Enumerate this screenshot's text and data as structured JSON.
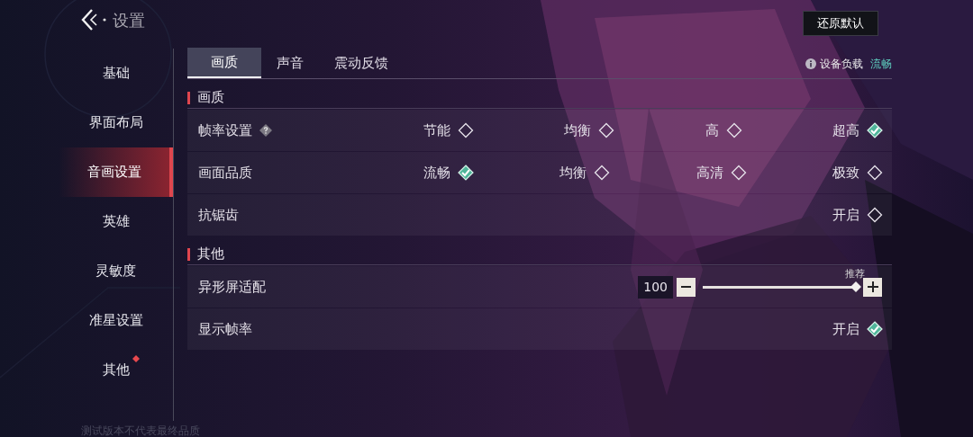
{
  "header": {
    "title": "设置",
    "reset_button": "还原默认"
  },
  "sidebar": {
    "items": [
      {
        "label": "基础",
        "selected": false,
        "badge": false
      },
      {
        "label": "界面布局",
        "selected": false,
        "badge": false
      },
      {
        "label": "音画设置",
        "selected": true,
        "badge": false
      },
      {
        "label": "英雄",
        "selected": false,
        "badge": false
      },
      {
        "label": "灵敏度",
        "selected": false,
        "badge": false
      },
      {
        "label": "准星设置",
        "selected": false,
        "badge": false
      },
      {
        "label": "其他",
        "selected": false,
        "badge": true
      }
    ]
  },
  "tabs": [
    {
      "label": "画质",
      "selected": true
    },
    {
      "label": "声音",
      "selected": false
    },
    {
      "label": "震动反馈",
      "selected": false
    }
  ],
  "device_load": {
    "label": "设备负载",
    "value": "流畅"
  },
  "sections": [
    {
      "title": "画质",
      "rows": [
        {
          "kind": "options",
          "label": "帧率设置",
          "help": true,
          "options": [
            {
              "label": "节能",
              "selected": false
            },
            {
              "label": "均衡",
              "selected": false
            },
            {
              "label": "高",
              "selected": false
            },
            {
              "label": "超高",
              "selected": true
            }
          ]
        },
        {
          "kind": "options",
          "label": "画面品质",
          "help": false,
          "options": [
            {
              "label": "流畅",
              "selected": true
            },
            {
              "label": "均衡",
              "selected": false
            },
            {
              "label": "高清",
              "selected": false
            },
            {
              "label": "极致",
              "selected": false
            }
          ]
        },
        {
          "kind": "toggle",
          "label": "抗锯齿",
          "value_label": "开启",
          "checked": false
        }
      ]
    },
    {
      "title": "其他",
      "rows": [
        {
          "kind": "slider",
          "label": "异形屏适配",
          "value": "100",
          "level": 1,
          "hint": "推荐"
        },
        {
          "kind": "toggle",
          "label": "显示帧率",
          "value_label": "开启",
          "checked": true
        }
      ]
    }
  ],
  "footer_note": "测试版本不代表最终品质"
}
